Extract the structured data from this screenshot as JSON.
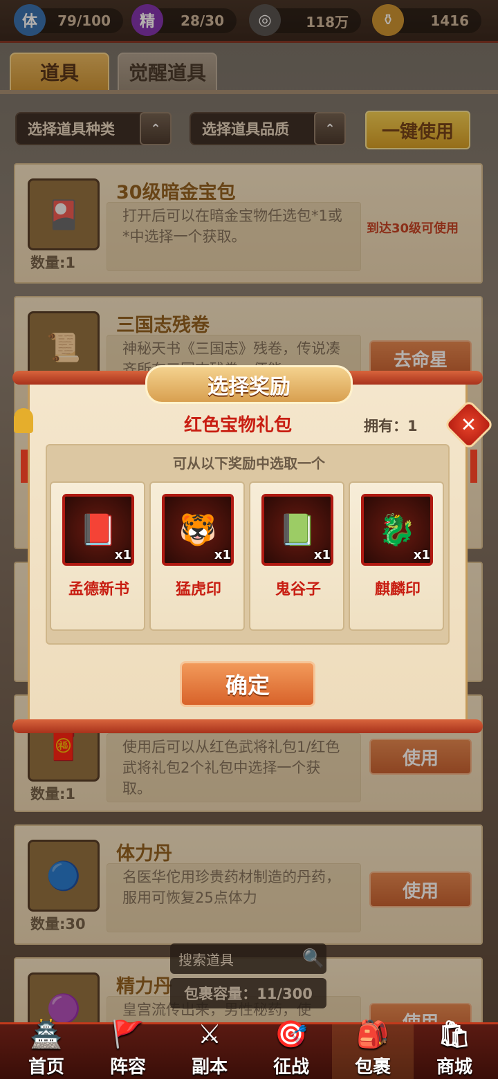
{
  "resources": [
    {
      "icon": "体",
      "icon_name": "stamina-icon",
      "value": "79/100"
    },
    {
      "icon": "精",
      "icon_name": "energy-icon",
      "value": "28/30"
    },
    {
      "icon": "◎",
      "icon_name": "coin-icon",
      "value": "118万"
    },
    {
      "icon": "⚱",
      "icon_name": "gold-ingot-icon",
      "value": "1416"
    }
  ],
  "tabs": [
    {
      "label": "道具"
    },
    {
      "label": "觉醒道具"
    }
  ],
  "filters": {
    "type_label": "选择道具种类",
    "quality_label": "选择道具品质",
    "arrow": "⌃",
    "use_all": "一键使用"
  },
  "items": [
    {
      "name": "30级暗金宝包",
      "desc": "打开后可以在暗金宝物任选包*1或*中选择一个获取。",
      "qty": "数量:1",
      "condition": "到达30级可使用",
      "icon": "🎴"
    },
    {
      "name": "三国志残卷",
      "desc": "神秘天书《三国志》残卷，传说凑齐所有三国志残卷，便能",
      "qty": "",
      "button": "去命星",
      "icon": "📜"
    },
    {
      "name": "",
      "desc": "使用后可以从红色武将礼包1/红色武将礼包2个礼包中选择一个获取。",
      "qty": "数量:1",
      "button": "使用",
      "icon": "🧧"
    },
    {
      "name": "体力丹",
      "desc": "名医华佗用珍贵药材制造的丹药，服用可恢复25点体力",
      "qty": "数量:30",
      "button": "使用",
      "icon": "🔵"
    },
    {
      "name": "精力丹",
      "desc": "皇宫流传出来，男性秘药，使",
      "qty": "",
      "button": "使用",
      "icon": "🟣"
    }
  ],
  "dialog": {
    "header": "选择奖励",
    "gift_title": "红色宝物礼包",
    "owned": "拥有：1",
    "hint": "可从以下奖励中选取一个",
    "close": "✕",
    "confirm": "确定",
    "rewards": [
      {
        "name": "孟德新书",
        "count": "x1",
        "icon": "📕"
      },
      {
        "name": "猛虎印",
        "count": "x1",
        "icon": "🐯"
      },
      {
        "name": "鬼谷子",
        "count": "x1",
        "icon": "📗"
      },
      {
        "name": "麒麟印",
        "count": "x1",
        "icon": "🐉"
      }
    ]
  },
  "search": {
    "placeholder": "搜索道具",
    "icon": "🔍",
    "capacity": "包裹容量：11/300"
  },
  "nav": [
    {
      "label": "首页",
      "icon": "🏯"
    },
    {
      "label": "阵容",
      "icon": "🚩"
    },
    {
      "label": "副本",
      "icon": "⚔"
    },
    {
      "label": "征战",
      "icon": "🎯"
    },
    {
      "label": "包裹",
      "icon": "🎒"
    },
    {
      "label": "商城",
      "icon": "🛍"
    }
  ]
}
